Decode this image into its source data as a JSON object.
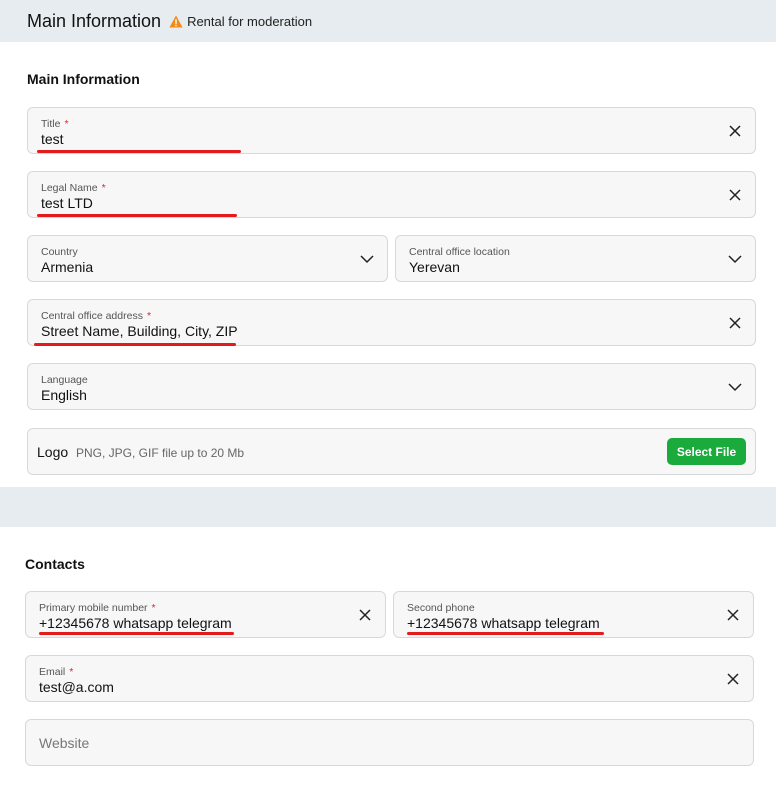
{
  "header": {
    "title": "Main Information",
    "status": "Rental for moderation",
    "status_icon": "warning-icon",
    "status_color": "#f08c1a"
  },
  "main_section": {
    "title": "Main Information",
    "title_field": {
      "label": "Title",
      "required_mark": "*",
      "value": "test"
    },
    "legal_name": {
      "label": "Legal Name",
      "required_mark": "*",
      "value": "test LTD"
    },
    "country": {
      "label": "Country",
      "value": "Armenia"
    },
    "office_location": {
      "label": "Central office location",
      "value": "Yerevan"
    },
    "office_address": {
      "label": "Central office address",
      "required_mark": "*",
      "value": "Street Name, Building, City, ZIP"
    },
    "language": {
      "label": "Language",
      "value": "English"
    },
    "logo": {
      "label": "Logo",
      "hint": "PNG, JPG, GIF file up to 20 Mb",
      "button": "Select File"
    }
  },
  "contacts_section": {
    "title": "Contacts",
    "primary_phone": {
      "label": "Primary mobile number",
      "required_mark": "*",
      "value": "+12345678 whatsapp telegram"
    },
    "second_phone": {
      "label": "Second phone",
      "value": "+12345678 whatsapp telegram"
    },
    "email": {
      "label": "Email",
      "required_mark": "*",
      "value": "test@a.com"
    },
    "website": {
      "placeholder": "Website"
    }
  },
  "colors": {
    "accent_green": "#1aab3c",
    "required_red": "#e0242c",
    "annotation_red": "#e31b1b",
    "band_gray": "#e6ecef"
  }
}
